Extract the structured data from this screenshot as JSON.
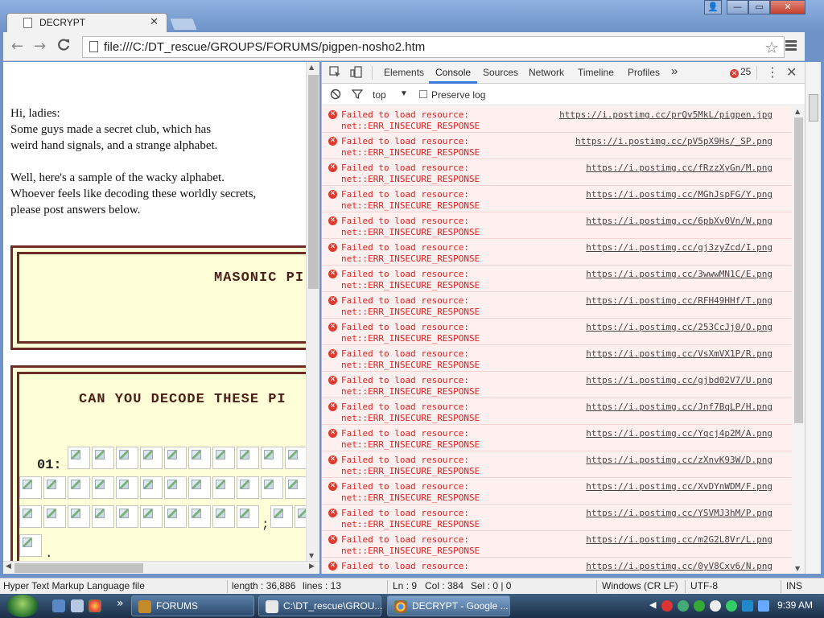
{
  "browser": {
    "tab_title": "DECRYPT",
    "tab_close": "✕",
    "window_buttons": {
      "user": "👤",
      "minimize": "—",
      "maximize": "▭",
      "close": "✕"
    },
    "back": "←",
    "forward": "→",
    "reload": "C",
    "url": "file:///C:/DT_rescue/GROUPS/FORUMS/pigpen-nosho2.htm",
    "star": "☆"
  },
  "page": {
    "intro_lines": [
      "Hi, ladies:",
      "Some guys made a secret club, which has",
      "weird hand signals, and a strange alphabet.",
      "",
      "Well, here's a sample of the wacky alphabet.",
      "Whoever feels like decoding these worldly secrets,",
      "please post answers below."
    ],
    "box1_heading": "MASONIC PI",
    "box2_heading": "CAN YOU DECODE THESE PI",
    "puzzle_number": "01:",
    "semicolon": ";",
    "period": "."
  },
  "devtools": {
    "tabs": [
      "Elements",
      "Console",
      "Sources",
      "Network",
      "Timeline",
      "Profiles"
    ],
    "active_tab": "Console",
    "more": "»",
    "error_count": "25",
    "kebab": "⋮",
    "close": "✕",
    "context": "top",
    "context_arrow": "▼",
    "preserve_log": "Preserve log",
    "messages": [
      {
        "line1": "Failed to load resource:",
        "line2": "net::ERR_INSECURE_RESPONSE",
        "url": "https://i.postimg.cc/prQv5MkL/pigpen.jpg"
      },
      {
        "line1": "Failed to load resource:",
        "line2": "net::ERR_INSECURE_RESPONSE",
        "url": "https://i.postimg.cc/pV5pX9Hs/_SP.png"
      },
      {
        "line1": "Failed to load resource:",
        "line2": "net::ERR_INSECURE_RESPONSE",
        "url": "https://i.postimg.cc/fRzzXyGn/M.png"
      },
      {
        "line1": "Failed to load resource:",
        "line2": "net::ERR_INSECURE_RESPONSE",
        "url": "https://i.postimg.cc/MGhJspFG/Y.png"
      },
      {
        "line1": "Failed to load resource:",
        "line2": "net::ERR_INSECURE_RESPONSE",
        "url": "https://i.postimg.cc/6pbXv0Vn/W.png"
      },
      {
        "line1": "Failed to load resource:",
        "line2": "net::ERR_INSECURE_RESPONSE",
        "url": "https://i.postimg.cc/gj3zyZcd/I.png"
      },
      {
        "line1": "Failed to load resource:",
        "line2": "net::ERR_INSECURE_RESPONSE",
        "url": "https://i.postimg.cc/3wwwMN1C/E.png"
      },
      {
        "line1": "Failed to load resource:",
        "line2": "net::ERR_INSECURE_RESPONSE",
        "url": "https://i.postimg.cc/RFH49HHf/T.png"
      },
      {
        "line1": "Failed to load resource:",
        "line2": "net::ERR_INSECURE_RESPONSE",
        "url": "https://i.postimg.cc/253CcJj0/O.png"
      },
      {
        "line1": "Failed to load resource:",
        "line2": "net::ERR_INSECURE_RESPONSE",
        "url": "https://i.postimg.cc/VsXmVX1P/R.png"
      },
      {
        "line1": "Failed to load resource:",
        "line2": "net::ERR_INSECURE_RESPONSE",
        "url": "https://i.postimg.cc/gjbd02V7/U.png"
      },
      {
        "line1": "Failed to load resource:",
        "line2": "net::ERR_INSECURE_RESPONSE",
        "url": "https://i.postimg.cc/Jnf7BqLP/H.png"
      },
      {
        "line1": "Failed to load resource:",
        "line2": "net::ERR_INSECURE_RESPONSE",
        "url": "https://i.postimg.cc/Yqcj4p2M/A.png"
      },
      {
        "line1": "Failed to load resource:",
        "line2": "net::ERR_INSECURE_RESPONSE",
        "url": "https://i.postimg.cc/zXnvK93W/D.png"
      },
      {
        "line1": "Failed to load resource:",
        "line2": "net::ERR_INSECURE_RESPONSE",
        "url": "https://i.postimg.cc/XvDYnWDM/F.png"
      },
      {
        "line1": "Failed to load resource:",
        "line2": "net::ERR_INSECURE_RESPONSE",
        "url": "https://i.postimg.cc/YSVMJ3hM/P.png"
      },
      {
        "line1": "Failed to load resource:",
        "line2": "net::ERR_INSECURE_RESPONSE",
        "url": "https://i.postimg.cc/m2G2L8Vr/L.png"
      },
      {
        "line1": "Failed to load resource:",
        "line2": "net::ERR_INSECURE_RESPONSE",
        "url": "https://i.postimg.cc/0yV8Cxv6/N.png"
      }
    ]
  },
  "statusbar": {
    "file_type": "Hyper Text Markup Language file",
    "length": "length : 36,886",
    "lines": "lines : 13",
    "ln": "Ln : 9",
    "col": "Col : 384",
    "sel": "Sel : 0 | 0",
    "eol": "Windows (CR LF)",
    "encoding": "UTF-8",
    "ins": "INS"
  },
  "taskbar": {
    "tasks": [
      {
        "label": "FORUMS",
        "active": false
      },
      {
        "label": "C:\\DT_rescue\\GROU...",
        "active": false
      },
      {
        "label": "DECRYPT - Google ...",
        "active": true
      }
    ],
    "more": "»",
    "tray_arrow": "◀",
    "time": "9:39 AM"
  }
}
